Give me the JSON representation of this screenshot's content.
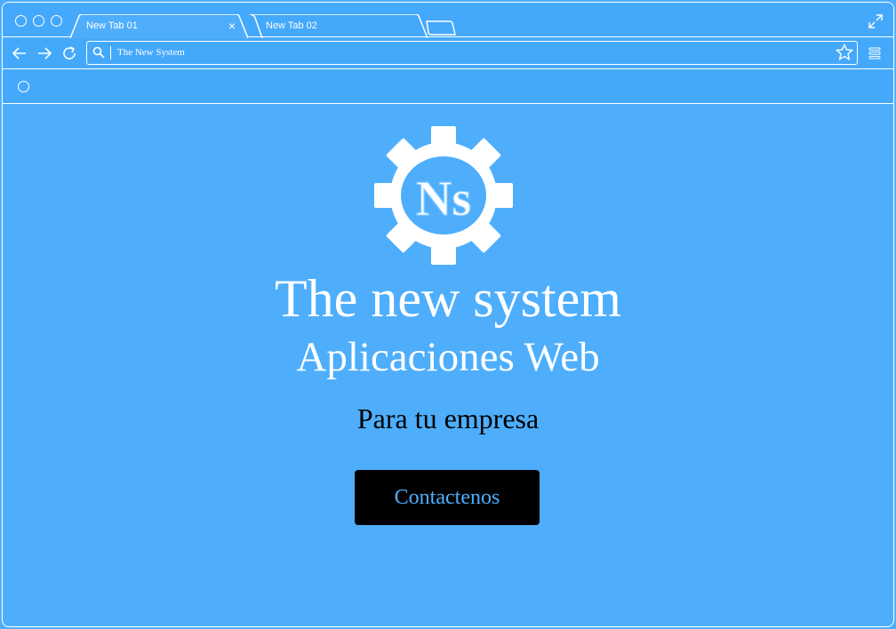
{
  "browser": {
    "tabs": [
      {
        "label": "New Tab 01",
        "active": true
      },
      {
        "label": "New Tab 02",
        "active": false
      }
    ],
    "close_glyph": "×",
    "address": {
      "text": "The New System"
    },
    "icons": {
      "back": "arrow-left-icon",
      "forward": "arrow-right-icon",
      "reload": "reload-icon",
      "search": "search-icon",
      "bookmark": "star-icon",
      "menu": "hamburger-menu-icon",
      "fullscreen": "expand-icon"
    }
  },
  "page": {
    "logo_text": "Ns",
    "title": "The new system",
    "subtitle": "Aplicaciones Web",
    "tagline": "Para tu empresa",
    "cta_label": "Contactenos"
  },
  "colors": {
    "background": "#4eaefc",
    "chrome": "#45a9fb",
    "button_bg": "#000000",
    "button_text": "#4eaefc"
  }
}
